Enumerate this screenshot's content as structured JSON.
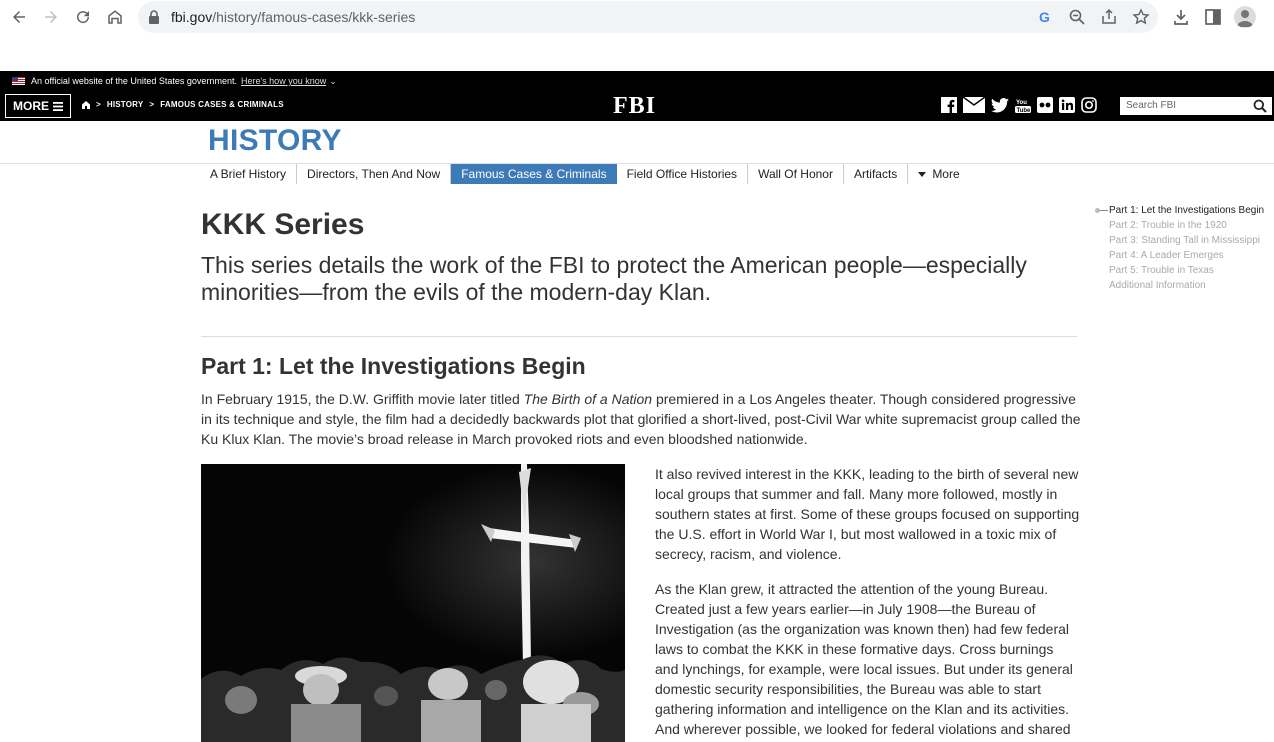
{
  "browser": {
    "url_domain": "fbi.gov",
    "url_path": "/history/famous-cases/kkk-series"
  },
  "gov_banner": {
    "text": "An official website of the United States government.",
    "link": "Here's how you know"
  },
  "header": {
    "more_label": "MORE",
    "breadcrumbs": [
      "HISTORY",
      "FAMOUS CASES & CRIMINALS"
    ],
    "logo": "FBI",
    "search_placeholder": "Search FBI"
  },
  "section": {
    "title": "HISTORY",
    "nav": [
      "A Brief History",
      "Directors, Then And Now",
      "Famous Cases & Criminals",
      "Field Office Histories",
      "Wall Of Honor",
      "Artifacts",
      "More"
    ]
  },
  "article": {
    "title": "KKK Series",
    "subtitle": "This series details the work of the FBI to protect the American people—especially minorities—from the evils of the modern-day Klan.",
    "part_heading": "Part 1: Let the Investigations Begin",
    "para1_a": "In February 1915, the D.W. Griffith movie later titled ",
    "para1_em": "The Birth of a Nation",
    "para1_b": " premiered in a Los Angeles theater. Though considered progressive in its technique and style, the film had a decidedly backwards plot that glorified a short-lived, post-Civil War white supremacist group called the Ku Klux Klan. The movie’s broad release in March provoked riots and even bloodshed nationwide.",
    "para2": "It also revived interest in the KKK, leading to the birth of several new local groups that summer and fall. Many more followed, mostly in southern states at first. Some of these groups focused on supporting the U.S. effort in World War I, but most wallowed in a toxic mix of secrecy, racism, and violence.",
    "para3": "As the Klan grew, it attracted the attention of the young Bureau. Created just a few years earlier—in July 1908—the Bureau of Investigation (as the organization was known then) had few federal laws to combat the KKK in these formative days. Cross burnings and lynchings, for example, were local issues. But under its general domestic security responsibilities, the Bureau was able to start gathering information and intelligence on the Klan and its activities. And wherever possible, we looked for federal violations and shared"
  },
  "toc": [
    "Part 1: Let the Investigations Begin",
    "Part 2: Trouble in the 1920",
    "Part 3: Standing Tall in Mississippi",
    "Part 4: A Leader Emerges",
    "Part 5: Trouble in Texas",
    "Additional Information"
  ],
  "colors": {
    "accent": "#3d7ab8",
    "header_bg": "#000000"
  }
}
